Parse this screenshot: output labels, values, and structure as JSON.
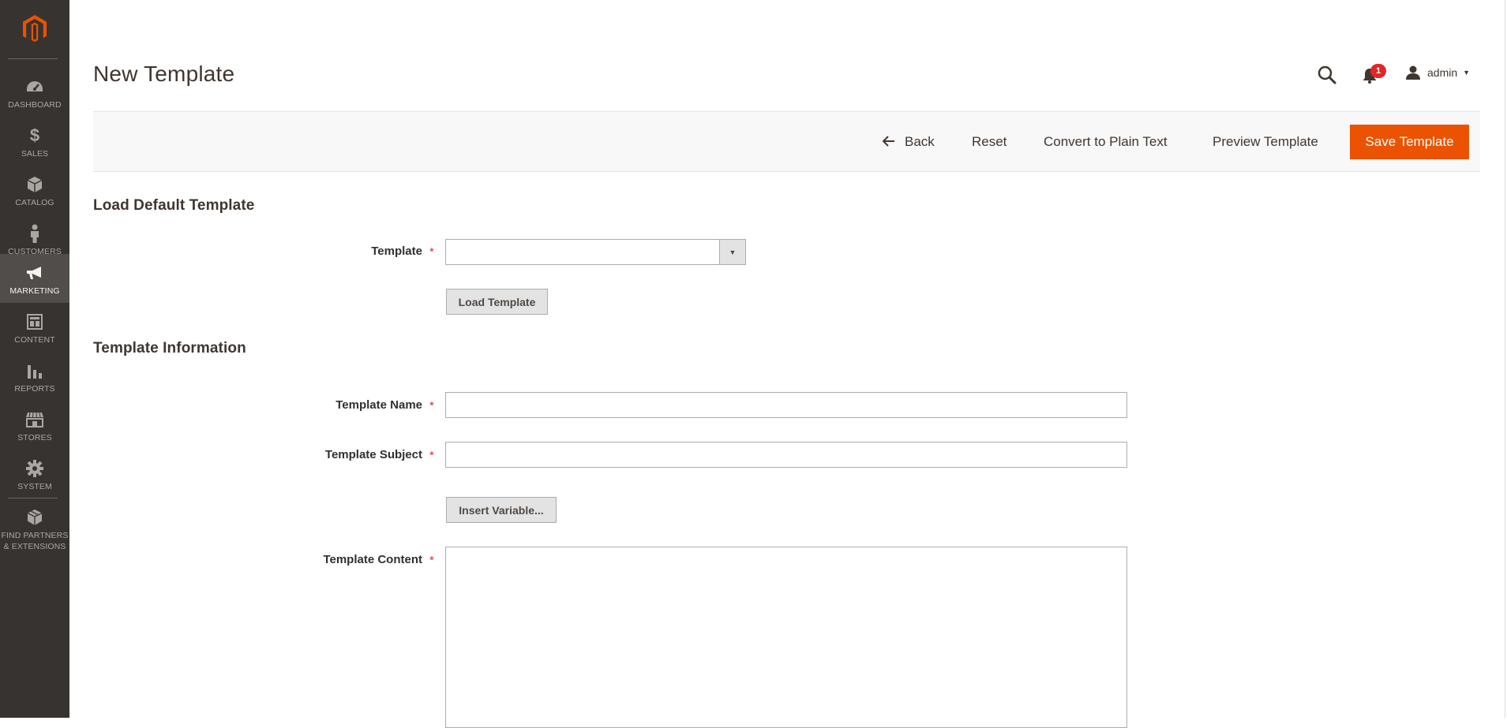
{
  "sidebar": {
    "items": [
      {
        "label": "DASHBOARD",
        "icon": "dashboard-icon"
      },
      {
        "label": "SALES",
        "icon": "dollar-icon"
      },
      {
        "label": "CATALOG",
        "icon": "box-icon"
      },
      {
        "label": "CUSTOMERS",
        "icon": "person-icon"
      },
      {
        "label": "MARKETING",
        "icon": "megaphone-icon"
      },
      {
        "label": "CONTENT",
        "icon": "layout-icon"
      },
      {
        "label": "REPORTS",
        "icon": "bar-chart-icon"
      },
      {
        "label": "STORES",
        "icon": "storefront-icon"
      },
      {
        "label": "SYSTEM",
        "icon": "gear-icon"
      },
      {
        "label_line1": "FIND PARTNERS",
        "label_line2": "& EXTENSIONS",
        "icon": "extensions-icon"
      }
    ],
    "active": "MARKETING"
  },
  "header": {
    "title": "New Template",
    "notifications_count": "1",
    "user_name": "admin"
  },
  "actions": {
    "back": "Back",
    "reset": "Reset",
    "convert": "Convert to Plain Text",
    "preview": "Preview Template",
    "save": "Save Template"
  },
  "load_section": {
    "title": "Load Default Template",
    "template_label": "Template",
    "template_value": "",
    "load_button": "Load Template"
  },
  "info_section": {
    "title": "Template Information",
    "name_label": "Template Name",
    "name_value": "",
    "subject_label": "Template Subject",
    "subject_value": "",
    "insert_variable_button": "Insert Variable...",
    "content_label": "Template Content",
    "content_value": ""
  },
  "colors": {
    "sidebar_bg": "#373330",
    "sidebar_active": "#514d4a",
    "accent": "#eb5202",
    "required": "#e22626"
  }
}
